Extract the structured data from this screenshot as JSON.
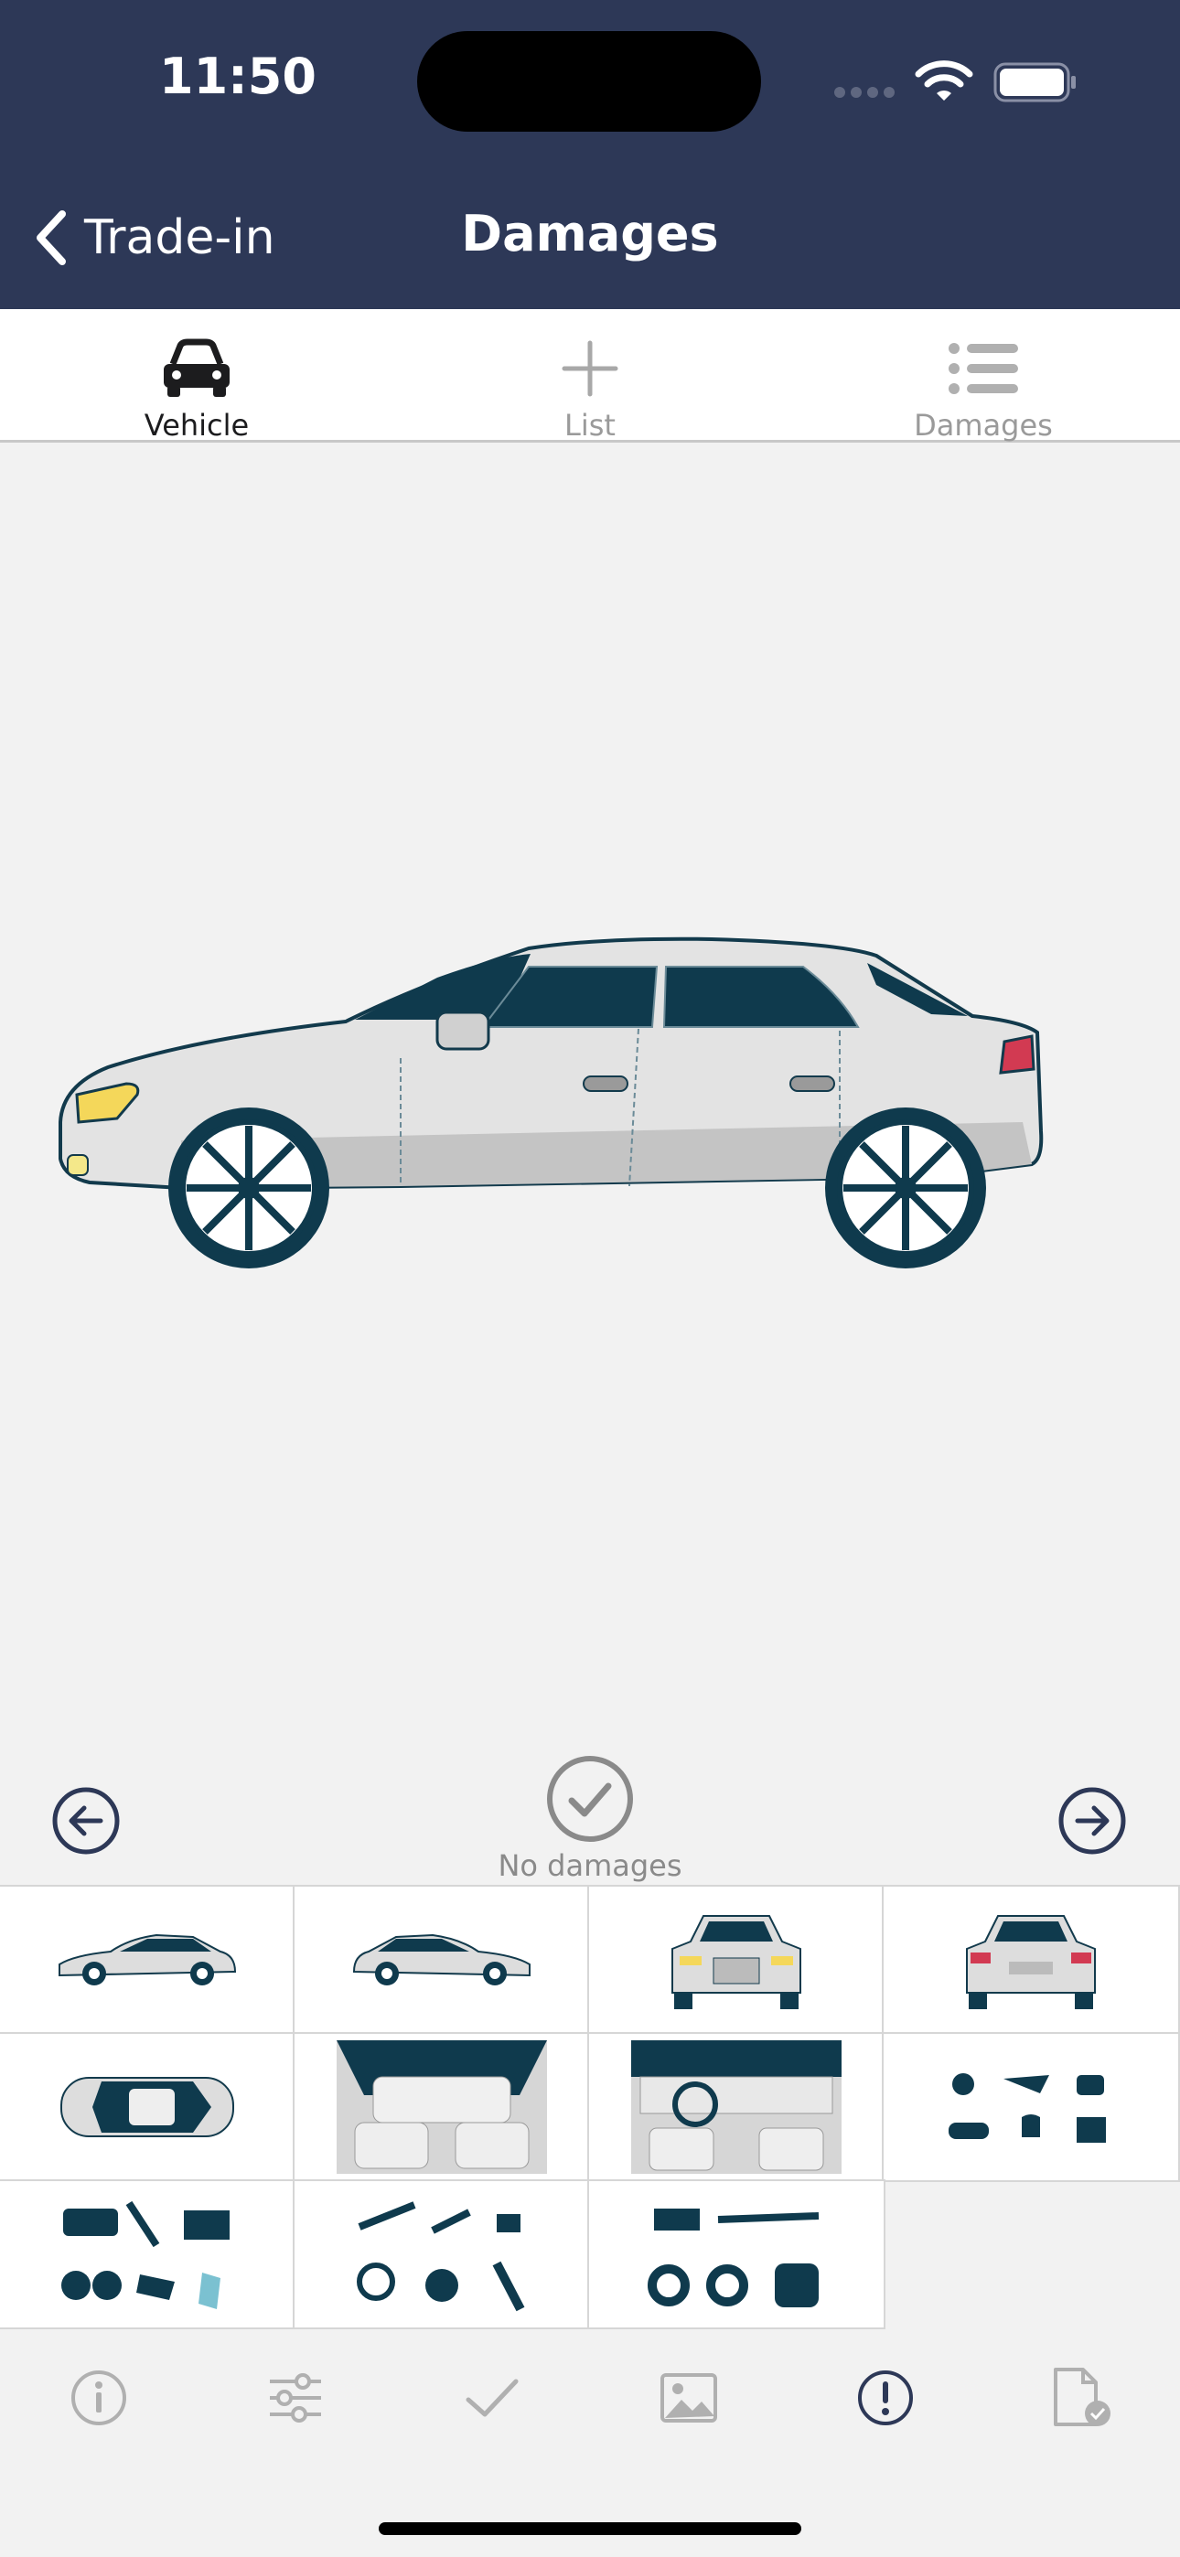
{
  "status_bar": {
    "time": "11:50"
  },
  "nav": {
    "back_label": "Trade-in",
    "title": "Damages"
  },
  "tabs": [
    {
      "label": "Vehicle",
      "icon": "car-icon",
      "active": true
    },
    {
      "label": "List",
      "icon": "plus-icon",
      "active": false
    },
    {
      "label": "Damages",
      "icon": "list-icon",
      "active": false
    }
  ],
  "viewer": {
    "current_view": "side-view-left",
    "no_damages_label": "No damages"
  },
  "thumbnails": [
    "car-side-left-thumbnail",
    "car-side-right-thumbnail",
    "car-front-thumbnail",
    "car-rear-thumbnail",
    "car-top-thumbnail",
    "interior-rear-thumbnail",
    "interior-dashboard-thumbnail",
    "engine-parts-thumbnail",
    "mechanical-parts-thumbnail",
    "suspension-parts-thumbnail",
    "drivetrain-parts-thumbnail"
  ],
  "toolbar": [
    {
      "icon": "info-icon",
      "active": false
    },
    {
      "icon": "sliders-icon",
      "active": false
    },
    {
      "icon": "checkmark-icon",
      "active": false
    },
    {
      "icon": "image-icon",
      "active": false
    },
    {
      "icon": "exclamation-circle-icon",
      "active": true
    },
    {
      "icon": "document-check-icon",
      "active": false
    }
  ],
  "colors": {
    "header_bg": "#2d3857",
    "accent": "#2d3857",
    "inactive": "#b0b0b0",
    "background": "#f2f2f2"
  }
}
